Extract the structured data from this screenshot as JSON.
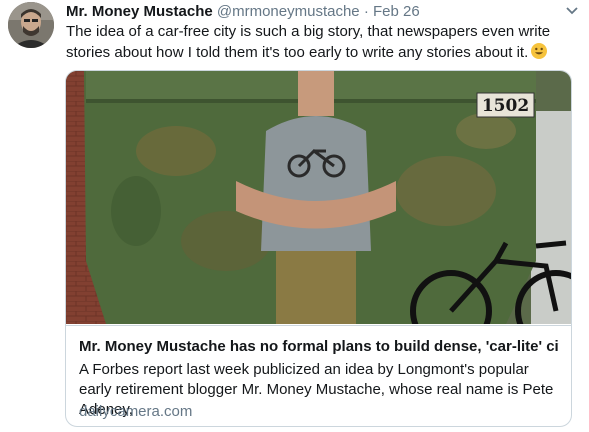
{
  "tweet": {
    "author_name": "Mr. Money Mustache",
    "handle": "@mrmoneymustache",
    "separator": "·",
    "date": "Feb 26",
    "text": "The idea of a car-free city is such a big story, that newspapers even write stories about how I told them it's too early to write any stories about it.",
    "emoji": "smiling-face-emoji",
    "avatar_icon": "user-avatar",
    "menu_icon": "chevron-down-icon"
  },
  "card": {
    "image_label": "1502",
    "title": "Mr. Money Mustache has no formal plans to build dense, 'car-lite' city…",
    "description": "A Forbes report last week publicized an idea by Longmont's popular early retirement blogger Mr. Money Mustache, whose real name is Pete Adeney,",
    "domain": "dailycamera.com"
  },
  "colors": {
    "text": "#14171a",
    "secondary": "#657786",
    "border": "#ccd6dd",
    "dumpster": "#4f6a3c"
  }
}
